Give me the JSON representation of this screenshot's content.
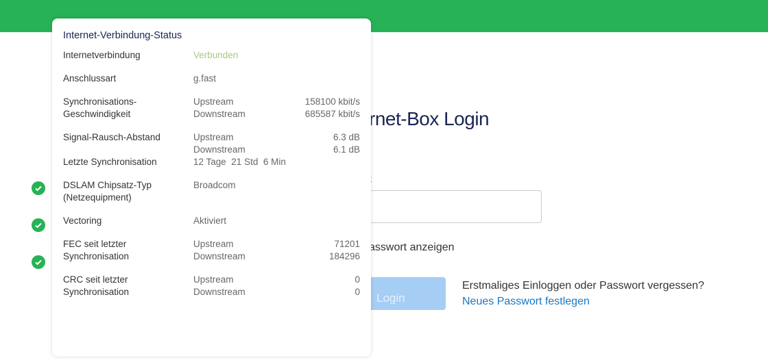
{
  "header": {
    "color": "#27b255"
  },
  "login": {
    "heading_visible": "rnet-Box Login",
    "password_label_visible": "t",
    "show_password_visible": "asswort anzeigen",
    "login_button": "Login",
    "first_login_text": "Erstmaliges Einloggen oder Passwort vergessen?",
    "new_password_link": "Neues Passwort festlegen"
  },
  "status_icons": [
    "check-icon",
    "check-icon",
    "check-icon"
  ],
  "popover": {
    "title": "Internet-Verbindung-Status",
    "connection": {
      "label": "Internetverbindung",
      "value": "Verbunden"
    },
    "type": {
      "label": "Anschlussart",
      "value": "g.fast"
    },
    "sync_speed": {
      "label1": "Synchronisations-",
      "label2": "Geschwindigkeit",
      "up_label": "Upstream",
      "up": "158100 kbit/s",
      "down_label": "Downstream",
      "down": "685587 kbit/s"
    },
    "snr": {
      "label": "Signal-Rausch-Abstand",
      "up_label": "Upstream",
      "up": "6.3 dB",
      "down_label": "Downstream",
      "down": "6.1 dB"
    },
    "last_sync": {
      "label": "Letzte Synchronisation",
      "value": "12 Tage  21 Std  6 Min"
    },
    "dslam": {
      "label1": "DSLAM Chipsatz-Typ",
      "label2": "(Netzequipment)",
      "value": "Broadcom"
    },
    "vectoring": {
      "label": "Vectoring",
      "value": "Aktiviert"
    },
    "fec": {
      "label1": "FEC seit letzter",
      "label2": "Synchronisation",
      "up_label": "Upstream",
      "up": "71201",
      "down_label": "Downstream",
      "down": "184296"
    },
    "crc": {
      "label1": "CRC seit letzter",
      "label2": "Synchronisation",
      "up_label": "Upstream",
      "up": "0",
      "down_label": "Downstream",
      "down": "0"
    }
  }
}
